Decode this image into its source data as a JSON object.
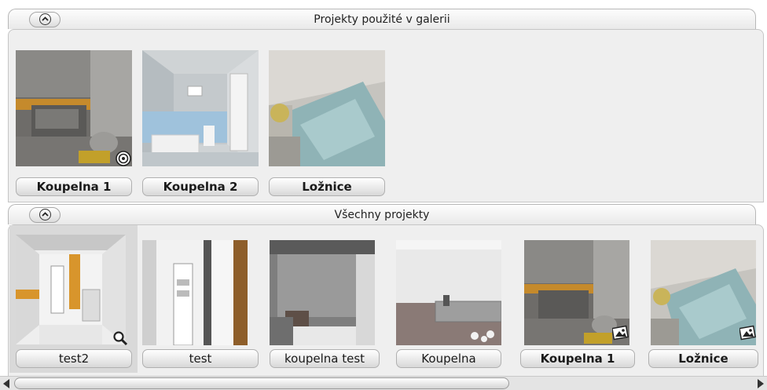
{
  "gallery_section": {
    "title": "Projekty použité v galerii",
    "collapse_icon": "chevron-up-icon",
    "items": [
      {
        "label": "Koupelna 1",
        "overlay_icon": "target-icon"
      },
      {
        "label": "Koupelna 2"
      },
      {
        "label": "Ložnice"
      }
    ]
  },
  "all_section": {
    "title": "Všechny projekty",
    "collapse_icon": "chevron-up-icon",
    "items": [
      {
        "label": "test2",
        "overlay_icon": "magnifier-icon",
        "selected": true
      },
      {
        "label": "test"
      },
      {
        "label": "koupelna test"
      },
      {
        "label": "Koupelna"
      },
      {
        "label": "Koupelna 1",
        "overlay_icon": "picture-icon"
      },
      {
        "label": "Ložnice",
        "overlay_icon": "picture-icon"
      }
    ]
  },
  "scrollbar": {
    "left_icon": "arrow-left-icon",
    "right_icon": "arrow-right-icon"
  }
}
